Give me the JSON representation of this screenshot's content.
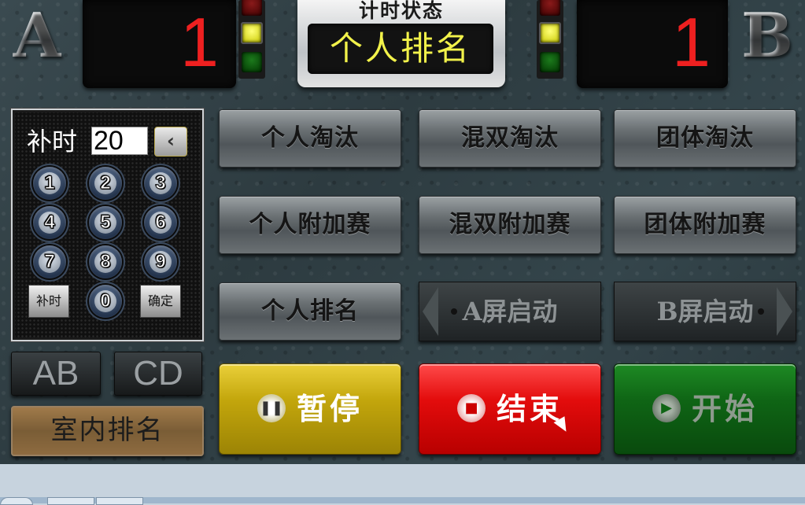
{
  "header": {
    "side_a_letter": "A",
    "side_b_letter": "B",
    "score_a": "1",
    "score_b": "1",
    "status_title": "计时状态",
    "status_value": "个人排名"
  },
  "keypad": {
    "label": "补时",
    "input_value": "20",
    "back_glyph": "‹",
    "keys": [
      "1",
      "2",
      "3",
      "4",
      "5",
      "6",
      "7",
      "8",
      "9",
      "0"
    ],
    "left_key": "补时",
    "right_key": "确定"
  },
  "modes": {
    "row1": [
      "个人淘汰",
      "混双淘汰",
      "团体淘汰"
    ],
    "row2": [
      "个人附加赛",
      "混双附加赛",
      "团体附加赛"
    ],
    "row3_left": "个人排名",
    "screen_a": "A屏启动",
    "screen_b": "B屏启动"
  },
  "bottom": {
    "ab": "AB",
    "cd": "CD",
    "indoor": "室内排名",
    "pause": "暂停",
    "stop": "结束",
    "start": "开始"
  },
  "colors": {
    "score_digit": "#ee2020",
    "status_text": "#f2f24a",
    "pause": "#c3a60c",
    "stop": "#e30c0c",
    "start": "#0f6515"
  },
  "icons": {
    "pause": "pause-circle-icon",
    "stop": "stop-circle-icon",
    "start": "play-circle-icon",
    "back": "chevron-left-icon"
  }
}
